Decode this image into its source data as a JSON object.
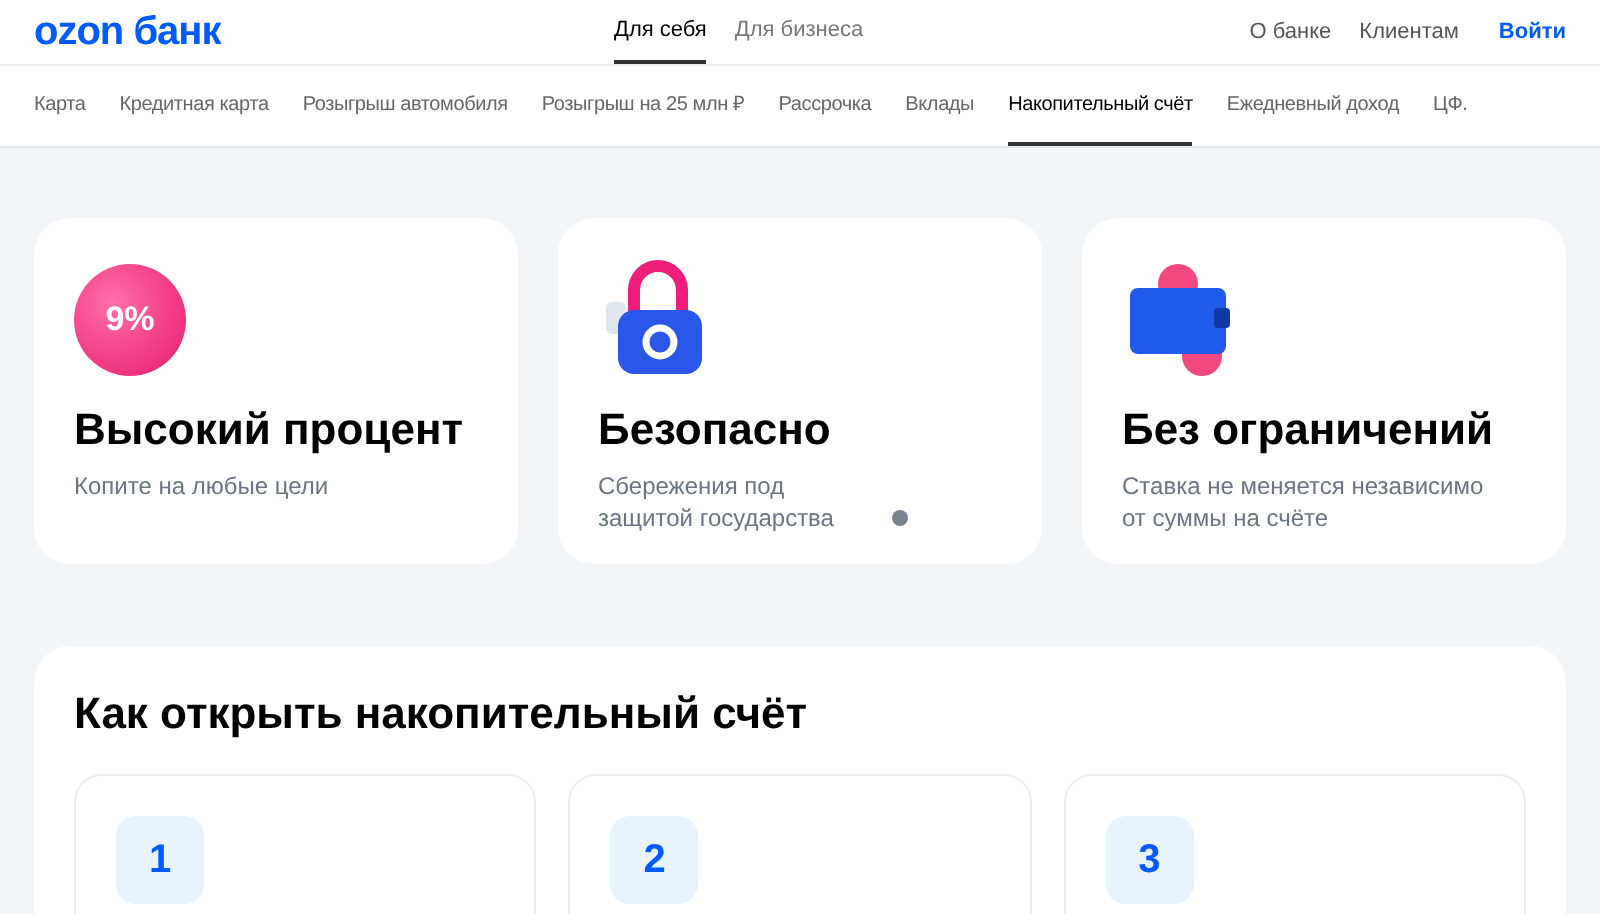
{
  "header": {
    "logo": "ozon банк",
    "segments": [
      {
        "label": "Для себя",
        "selected": true
      },
      {
        "label": "Для бизнеса",
        "selected": false
      }
    ],
    "links": [
      "О банке",
      "Клиентам"
    ],
    "login": "Войти"
  },
  "nav": [
    {
      "label": "Карта",
      "selected": false
    },
    {
      "label": "Кредитная карта",
      "selected": false
    },
    {
      "label": "Розыгрыш автомобиля",
      "selected": false
    },
    {
      "label": "Розыгрыш на 25 млн ₽",
      "selected": false
    },
    {
      "label": "Рассрочка",
      "selected": false
    },
    {
      "label": "Вклады",
      "selected": false
    },
    {
      "label": "Накопительный счёт",
      "selected": true
    },
    {
      "label": "Ежедневный доход",
      "selected": false
    },
    {
      "label": "ЦФ.",
      "selected": false
    }
  ],
  "features": [
    {
      "kind": "percent",
      "badge": "9%",
      "title": "Высокий процент",
      "text": "Копите на любые цели",
      "info": false
    },
    {
      "kind": "lock",
      "title": "Безопасно",
      "text": "Сбережения под защитой государства",
      "info": true
    },
    {
      "kind": "wallet",
      "title": "Без ограничений",
      "text": "Ставка не меняется независимо от суммы на счёте",
      "info": false
    }
  ],
  "steps_section": {
    "title": "Как открыть накопительный счёт",
    "steps": [
      "1",
      "2",
      "3"
    ]
  }
}
